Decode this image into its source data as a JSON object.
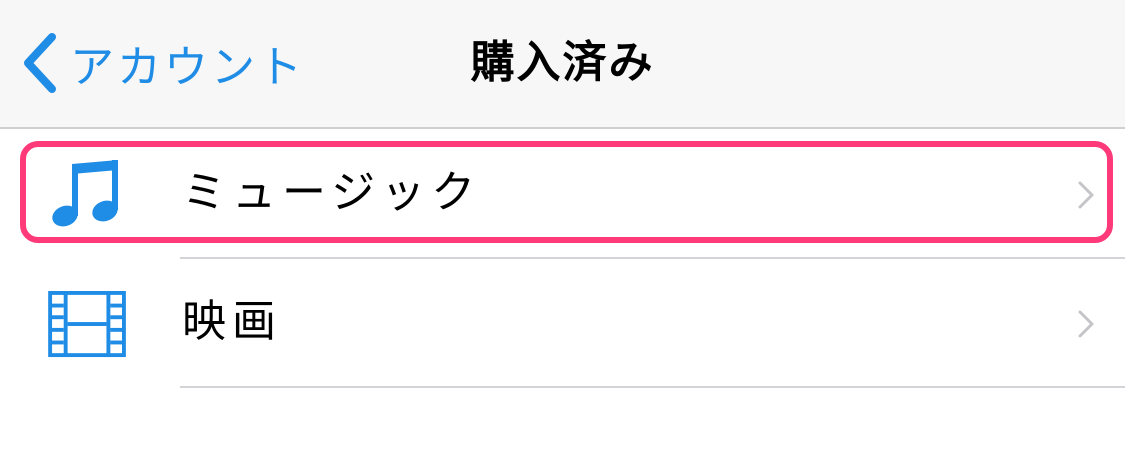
{
  "navbar": {
    "back_label": "アカウント",
    "back_icon": "chevron-left-icon",
    "title": "購入済み"
  },
  "list": {
    "items": [
      {
        "label": "ミュージック",
        "icon": "music-note-icon",
        "highlighted": true
      },
      {
        "label": "映画",
        "icon": "film-strip-icon",
        "highlighted": false
      }
    ]
  },
  "colors": {
    "accent": "#1f8ce6",
    "highlight": "#ff3a7a",
    "navbar_background": "#f7f7f7",
    "separator": "#d3d3d8",
    "chevron": "#c4c4c9"
  }
}
